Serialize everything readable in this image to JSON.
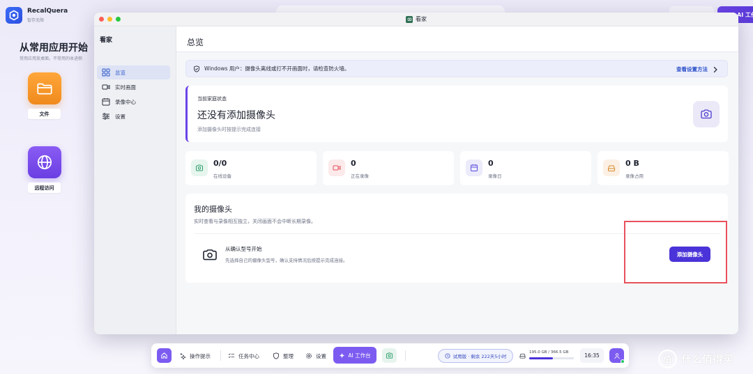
{
  "desktop": {
    "brand_name": "RecalQuera",
    "brand_tagline": "智存无限",
    "title": "从常用应用开始",
    "subtitle": "常用应用放桌面。不常用的收进侧",
    "apps": [
      {
        "label": "文件",
        "icon": "folder-icon",
        "color": "#f5961f"
      },
      {
        "label": "远程访问",
        "icon": "globe-icon",
        "color": "#7a4df0"
      }
    ],
    "top_ai_label": "AI 工作台"
  },
  "window": {
    "title": "看家",
    "sidebar": {
      "title": "看家",
      "items": [
        {
          "label": "总览",
          "icon": "grid-icon",
          "active": true
        },
        {
          "label": "实时画面",
          "icon": "video-icon"
        },
        {
          "label": "录像中心",
          "icon": "calendar-icon"
        },
        {
          "label": "设置",
          "icon": "sliders-icon"
        }
      ]
    },
    "page_title": "总览",
    "notice": {
      "text": "Windows 用户：摄像头离线或打不开画面时，请检查防火墙。",
      "link": "查看设置方法"
    },
    "status": {
      "label": "当前家庭状态",
      "headline": "还没有添加摄像头",
      "sub": "添加摄像头时按提示完成连接"
    },
    "stats": [
      {
        "value": "0/0",
        "label": "在线设备",
        "icon": "camera-icon",
        "color": "#2e9e6b",
        "bg": "#e6f5ee"
      },
      {
        "value": "0",
        "label": "正在录像",
        "icon": "video-icon",
        "color": "#e0525a",
        "bg": "#fdeaeb"
      },
      {
        "value": "0",
        "label": "录像日",
        "icon": "calendar-icon",
        "color": "#5a4ee0",
        "bg": "#ecebfb"
      },
      {
        "value": "0 B",
        "label": "录像占用",
        "icon": "drive-icon",
        "color": "#d9892b",
        "bg": "#fbf0e3"
      }
    ],
    "cameras": {
      "title": "我的摄像头",
      "sub": "实时查看与录像相互独立，关闭画面不会中断长期录像。",
      "empty_title": "从确认型号开始",
      "empty_desc": "先选择自己的摄像头型号，确认支持情况后按提示完成连接。",
      "add_button": "添加摄像头"
    }
  },
  "dock": {
    "items": [
      {
        "label": "操作提示",
        "icon": "sparkle-icon"
      },
      {
        "label": "任务中心",
        "icon": "list-icon"
      },
      {
        "label": "整理",
        "icon": "shield-icon"
      },
      {
        "label": "设置",
        "icon": "gear-icon"
      }
    ],
    "ai_label": "AI 工作台",
    "trial": "试用版 · 剩余 222天5小时",
    "storage_text": "195.0 GB / 366.5 GB",
    "storage_fraction": 0.532,
    "clock": "16:35"
  },
  "watermark": {
    "badge": "值",
    "text": "什么值得买"
  }
}
